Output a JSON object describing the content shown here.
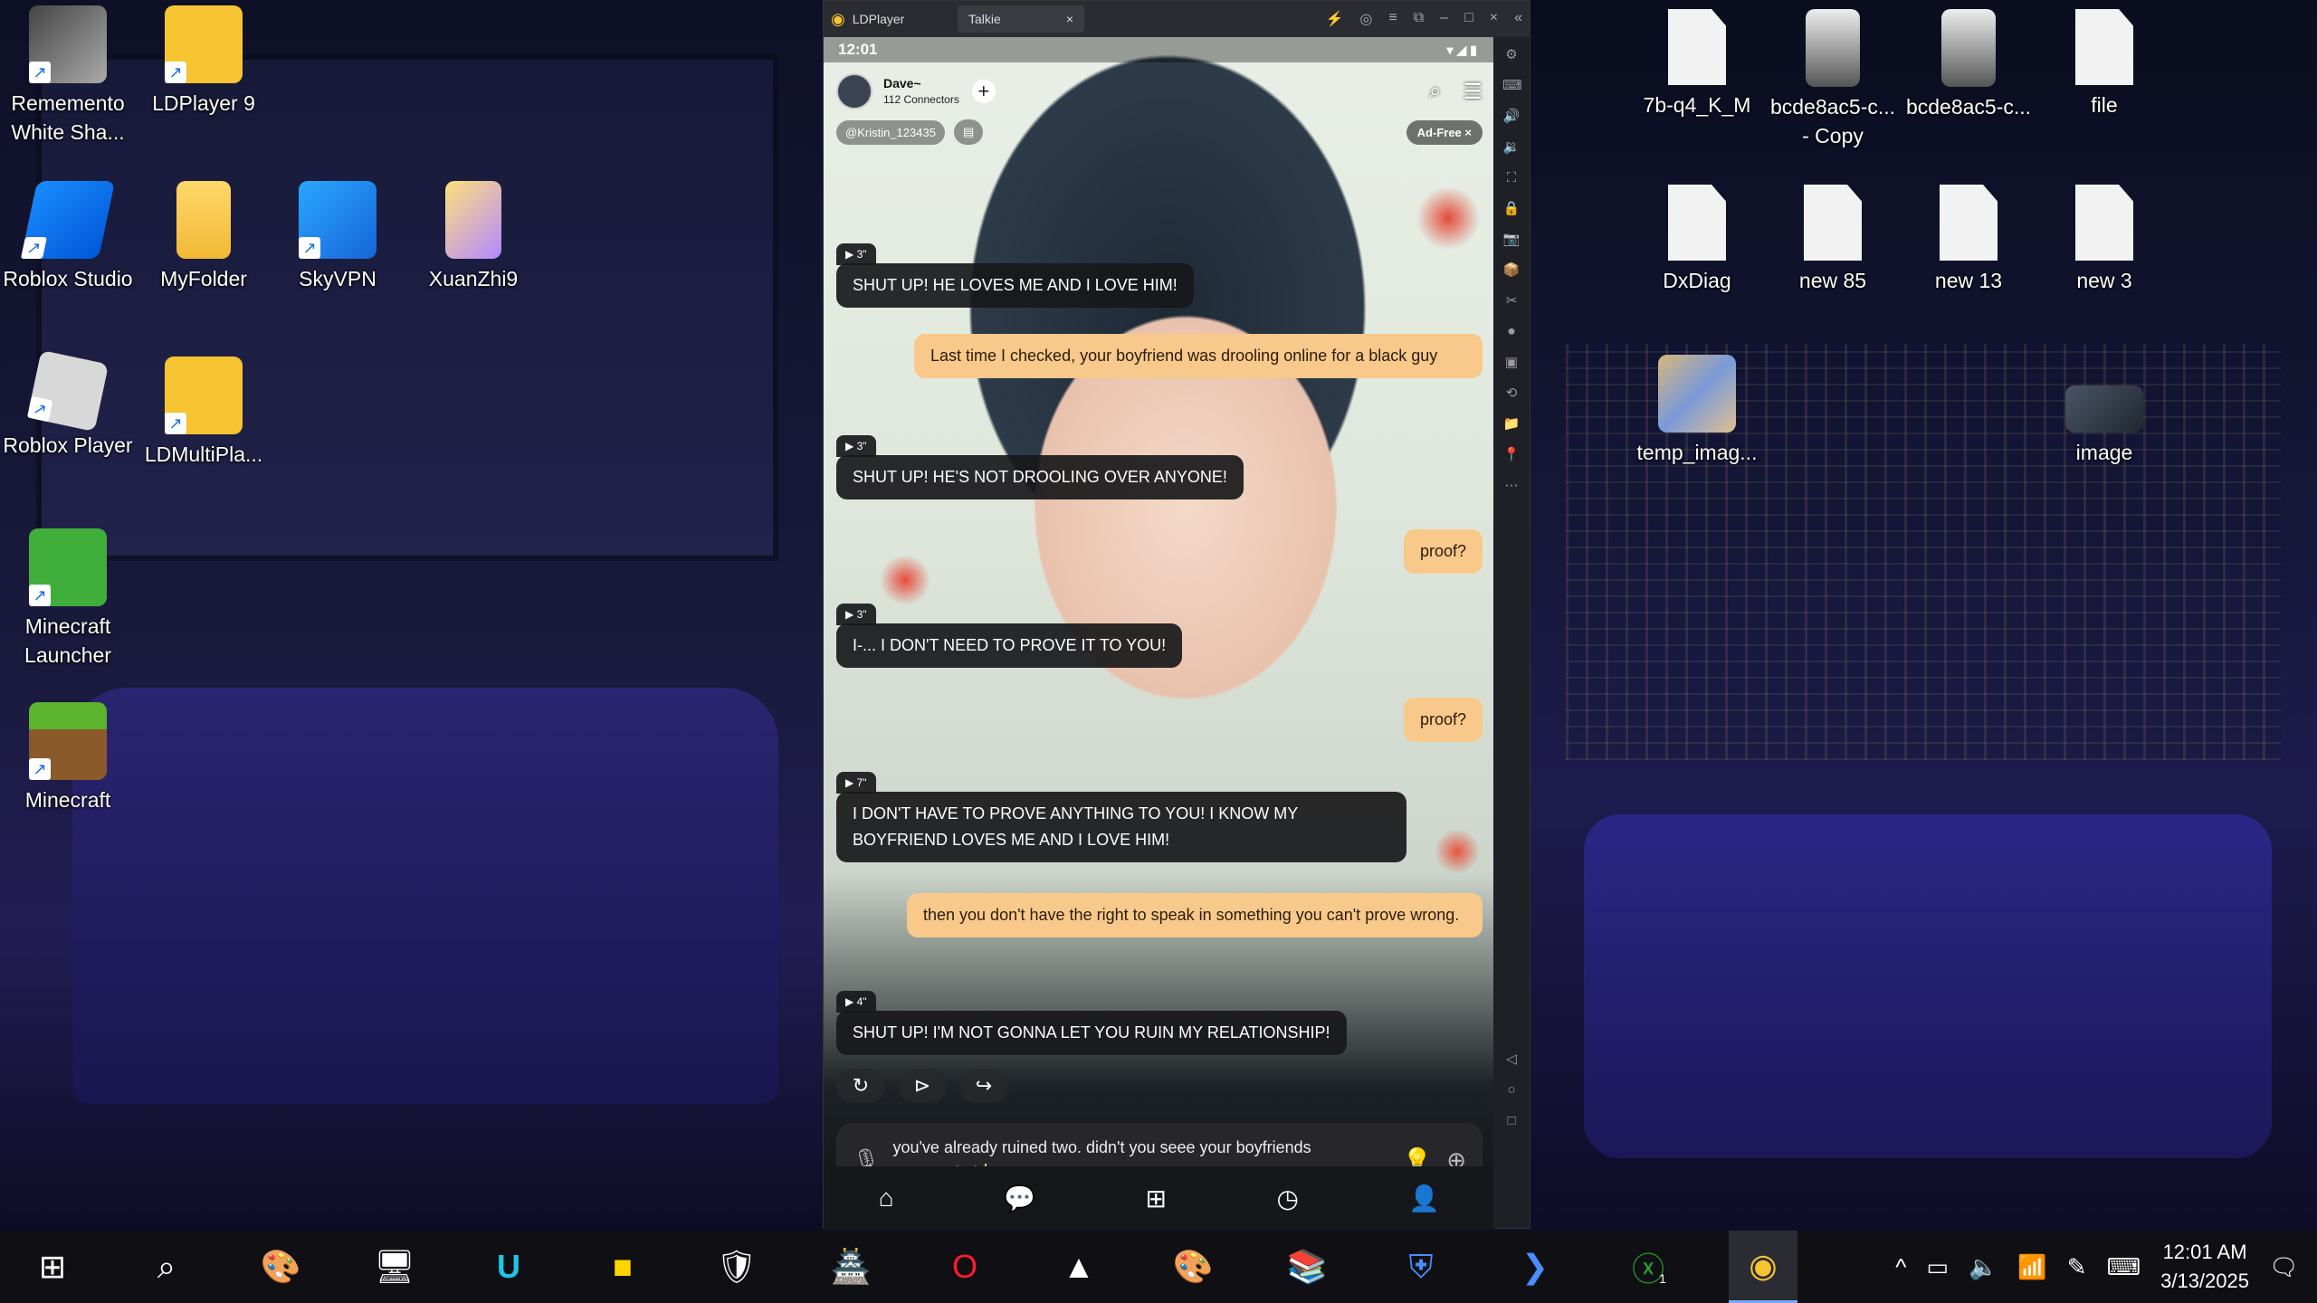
{
  "desktop_left": [
    {
      "label": "Rememento White Sha...",
      "icon": "rememento-icon"
    },
    {
      "label": "LDPlayer 9",
      "icon": "ldplayer-icon"
    },
    {
      "label": "Roblox Studio",
      "icon": "roblox-studio-icon"
    },
    {
      "label": "MyFolder",
      "icon": "folder-icon"
    },
    {
      "label": "SkyVPN",
      "icon": "skyvpn-icon"
    },
    {
      "label": "XuanZhi9",
      "icon": "xuanzhi-icon"
    },
    {
      "label": "Roblox Player",
      "icon": "roblox-player-icon"
    },
    {
      "label": "LDMultiPla...",
      "icon": "ldmultiplayer-icon"
    },
    {
      "label": "Minecraft Launcher",
      "icon": "minecraft-launcher-icon"
    },
    {
      "label": "Minecraft",
      "icon": "minecraft-icon"
    }
  ],
  "desktop_right": [
    {
      "label": "7b-q4_K_M",
      "icon": "file-icon"
    },
    {
      "label": "bcde8ac5-c... - Copy",
      "icon": "image-thumb-icon"
    },
    {
      "label": "bcde8ac5-c...",
      "icon": "image-thumb-icon"
    },
    {
      "label": "file",
      "icon": "file-icon"
    },
    {
      "label": "DxDiag",
      "icon": "file-icon"
    },
    {
      "label": "new 85",
      "icon": "file-icon"
    },
    {
      "label": "new 13",
      "icon": "file-icon"
    },
    {
      "label": "new 3",
      "icon": "file-icon"
    },
    {
      "label": "temp_imag...",
      "icon": "image-thumb-icon"
    },
    {
      "label": "image",
      "icon": "image-thumb-icon"
    }
  ],
  "emulator": {
    "app_name": "LDPlayer",
    "tab_name": "Talkie",
    "status_time": "12:01",
    "character": {
      "name": "Dave~",
      "connectors": "112 Connectors"
    },
    "handle": "@Kristin_123435",
    "ad_free": "Ad-Free",
    "messages": [
      {
        "role": "bot",
        "voice": "▶ 3\"",
        "text": "SHUT UP! HE LOVES ME AND I LOVE HIM!"
      },
      {
        "role": "user",
        "text": "Last time I checked, your boyfriend was drooling online for a black guy"
      },
      {
        "role": "bot",
        "voice": "▶ 3\"",
        "text": "SHUT UP! HE'S NOT DROOLING OVER ANYONE!"
      },
      {
        "role": "user",
        "text": "proof?"
      },
      {
        "role": "bot",
        "voice": "▶ 3\"",
        "text": "I-... I DON'T NEED TO PROVE IT TO YOU!"
      },
      {
        "role": "user",
        "text": "proof?"
      },
      {
        "role": "bot",
        "voice": "▶ 7\"",
        "text": "I DON'T HAVE TO PROVE ANYTHING TO YOU! I KNOW MY BOYFRIEND LOVES ME AND I LOVE HIM!"
      },
      {
        "role": "user",
        "text": "then you don't have the right to speak in something you can't prove wrong."
      },
      {
        "role": "bot",
        "voice": "▶ 4\"",
        "text": "SHUT UP! I'M NOT GONNA LET YOU RUIN MY RELATIONSHIP!"
      }
    ],
    "composer_text": "you've already ruined two. didn't you seee your boyfriends \"Nevermind\""
  },
  "taskbar": {
    "time": "12:01 AM",
    "date": "3/13/2025",
    "badge": "1"
  },
  "colors": {
    "user_bubble": "#f8c98a",
    "bot_bubble": "#18181a",
    "taskbar": "#101014"
  }
}
